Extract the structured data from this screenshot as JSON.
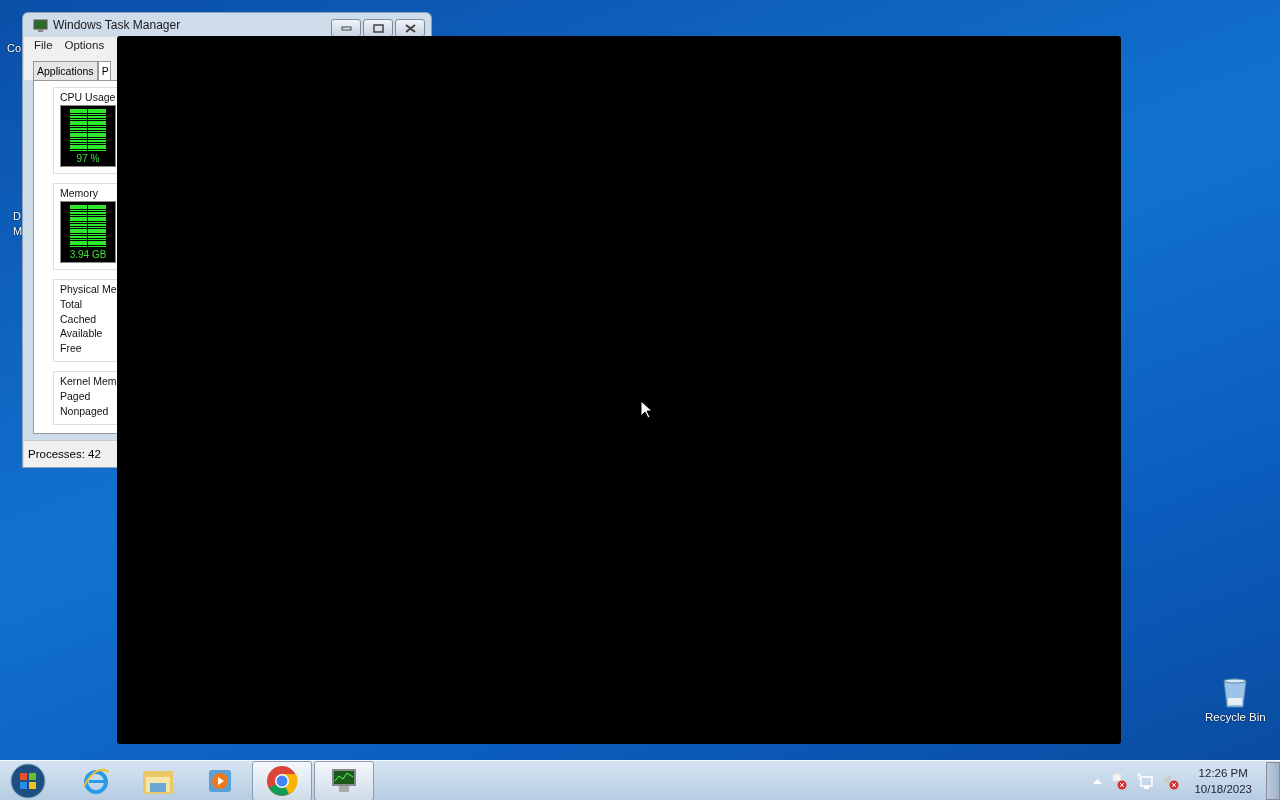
{
  "desktop": {
    "icon_labels_cut": [
      {
        "text": "Co"
      },
      {
        "text": "D"
      },
      {
        "text": "M"
      }
    ],
    "recycle_bin": {
      "label": "Recycle Bin"
    }
  },
  "task_manager": {
    "title": "Windows Task Manager",
    "menu": [
      "File",
      "Options"
    ],
    "tabs": [
      {
        "label": "Applications",
        "selected": false
      },
      {
        "label": "P",
        "selected": true
      }
    ],
    "meters": [
      {
        "title": "CPU Usage",
        "reading": "97 %"
      },
      {
        "title": "Memory",
        "reading": "3.94 GB"
      }
    ],
    "groups": [
      {
        "title": "Physical Me",
        "rows": [
          "Total",
          "Cached",
          "Available",
          "Free"
        ]
      },
      {
        "title": "Kernel Mem",
        "rows": [
          "Paged",
          "Nonpaged"
        ]
      }
    ],
    "status_bar": "Processes: 42"
  },
  "taskbar": {
    "apps": [
      {
        "kind": "ie",
        "open": false
      },
      {
        "kind": "folder",
        "open": false
      },
      {
        "kind": "media",
        "open": false
      },
      {
        "kind": "chrome",
        "open": true
      },
      {
        "kind": "taskmgr",
        "open": true
      }
    ],
    "tray": {
      "time": "12:26 PM",
      "date": "10/18/2023"
    }
  }
}
